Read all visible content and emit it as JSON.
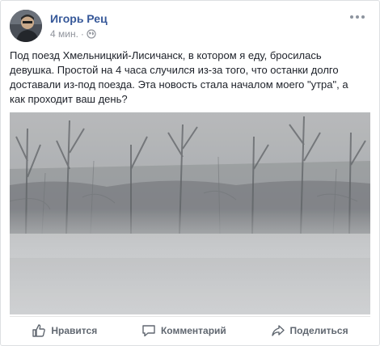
{
  "post": {
    "author": "Игорь Рец",
    "time": "4 мин.",
    "separator": "·",
    "text": "Под поезд Хмельницкий-Лисичанск, в котором я еду, бросилась девушка. Простой на 4 часа случился из-за того, что останки долго доставали из-под поезда. Эта новость стала началом моего \"утра\", а как проходит ваш день?",
    "photo_icon": "foggy-landscape-photo",
    "privacy_icon": "globe-icon"
  },
  "actions": {
    "like": "Нравится",
    "comment": "Комментарий",
    "share": "Поделиться"
  },
  "colors": {
    "author_link": "#365899",
    "meta_text": "#90949c",
    "action_text": "#606770"
  }
}
